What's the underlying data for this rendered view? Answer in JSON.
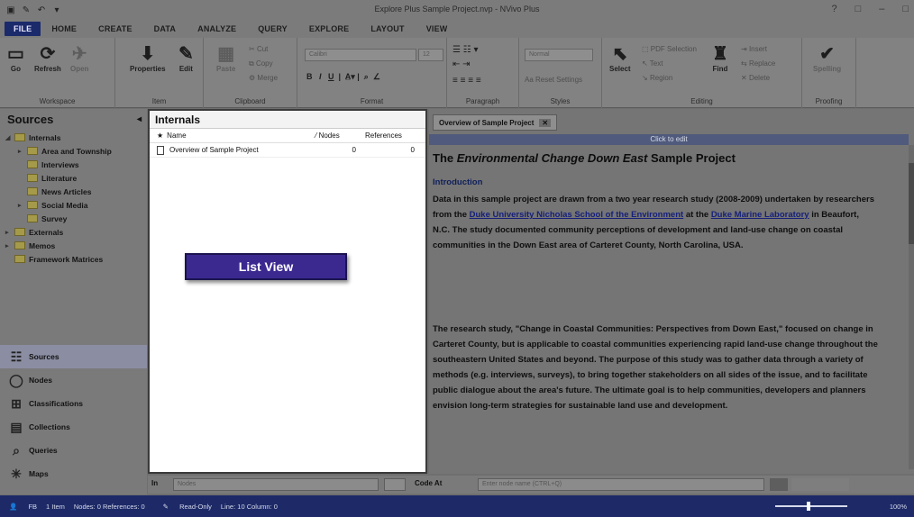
{
  "window": {
    "title": "Explore Plus Sample Project.nvp - NVivo Plus",
    "controls": [
      "?",
      "□",
      "–",
      "□"
    ]
  },
  "qat_icons": [
    "save-icon",
    "edit-icon",
    "undo-icon",
    "redo-icon"
  ],
  "tabs": [
    "FILE",
    "HOME",
    "CREATE",
    "DATA",
    "ANALYZE",
    "QUERY",
    "EXPLORE",
    "LAYOUT",
    "VIEW"
  ],
  "ribbon": {
    "workspace": {
      "go": "Go",
      "refresh": "Refresh",
      "open": "Open",
      "label": "Workspace"
    },
    "item": {
      "properties": "Properties",
      "edit": "Edit",
      "label": "Item"
    },
    "clipboard": {
      "paste": "Paste",
      "cut": "Cut",
      "copy": "Copy",
      "merge": "Merge",
      "label": "Clipboard"
    },
    "format": {
      "font": "Calibri",
      "size": "12",
      "bold": "B",
      "italic": "I",
      "underline": "U",
      "label": "Format"
    },
    "paragraph": {
      "label": "Paragraph"
    },
    "styles": {
      "style": "Normal",
      "reset": "Reset Settings",
      "label": "Styles"
    },
    "editing": {
      "select": "Select",
      "pdf_selection": "PDF Selection",
      "text": "Text",
      "region": "Region",
      "find": "Find",
      "insert": "Insert",
      "replace": "Replace",
      "delete": "Delete",
      "label": "Editing"
    },
    "proofing": {
      "spelling": "Spelling",
      "label": "Proofing"
    }
  },
  "nav": {
    "header": "Sources",
    "tree": [
      {
        "label": "Internals",
        "level": 0,
        "arrow": "◢"
      },
      {
        "label": "Area and Township",
        "level": 1,
        "arrow": "▸"
      },
      {
        "label": "Interviews",
        "level": 1,
        "arrow": ""
      },
      {
        "label": "Literature",
        "level": 1,
        "arrow": ""
      },
      {
        "label": "News Articles",
        "level": 1,
        "arrow": ""
      },
      {
        "label": "Social Media",
        "level": 1,
        "arrow": "▸"
      },
      {
        "label": "Survey",
        "level": 1,
        "arrow": ""
      },
      {
        "label": "Externals",
        "level": 0,
        "arrow": "▸"
      },
      {
        "label": "Memos",
        "level": 0,
        "arrow": "▸"
      },
      {
        "label": "Framework Matrices",
        "level": 0,
        "arrow": ""
      }
    ],
    "buttons": [
      {
        "label": "Sources",
        "icon": "☷",
        "selected": true
      },
      {
        "label": "Nodes",
        "icon": "◯",
        "selected": false
      },
      {
        "label": "Classifications",
        "icon": "⊞",
        "selected": false
      },
      {
        "label": "Collections",
        "icon": "▤",
        "selected": false
      },
      {
        "label": "Queries",
        "icon": "⌕",
        "selected": false
      },
      {
        "label": "Maps",
        "icon": "✳",
        "selected": false
      }
    ]
  },
  "listview": {
    "title": "Internals",
    "columns": {
      "name": "Name",
      "nodes": "Nodes",
      "references": "References"
    },
    "rows": [
      {
        "name": "Overview of Sample Project",
        "nodes": "0",
        "references": "0"
      }
    ]
  },
  "callout": {
    "text": "List View"
  },
  "detail": {
    "tab": "Overview of Sample Project",
    "edit_link": "Click to edit",
    "title_pre": "The ",
    "title_italic": "Environmental Change Down East",
    "title_post": " Sample Project",
    "intro_heading": "Introduction",
    "p1_a": "Data in this sample project are drawn from a two year research study (2008-2009) undertaken by researchers from the ",
    "p1_link1": "Duke University Nicholas School of the Environment",
    "p1_b": " at the ",
    "p1_link2": "Duke Marine Laboratory",
    "p1_c": " in Beaufort, N.C. The study documented community perceptions of development and land-use change on coastal communities in the Down East area of Carteret County, North Carolina, USA.",
    "p2": "The research study, \"Change in Coastal Communities: Perspectives from Down East,\" focused on change in Carteret County, but is applicable to coastal communities experiencing rapid land-use change throughout the southeastern United States and beyond. The purpose of this study was to gather data through a variety of methods (e.g. interviews, surveys), to bring together stakeholders on all sides of the issue, and to facilitate public dialogue about the area's future. The ultimate goal is to help communities, developers and planners envision long-term strategies for sustainable land use and development."
  },
  "findbar": {
    "in_label": "In",
    "in_value": "Nodes",
    "code_label": "Code At",
    "code_placeholder": "Enter node name (CTRL+Q)"
  },
  "status": {
    "user": "FB",
    "items": "1 Item",
    "nodes_refs": "Nodes: 0  References: 0",
    "readonly": "Read-Only",
    "line_col": "Line: 10  Column: 0",
    "zoom": "100%"
  }
}
